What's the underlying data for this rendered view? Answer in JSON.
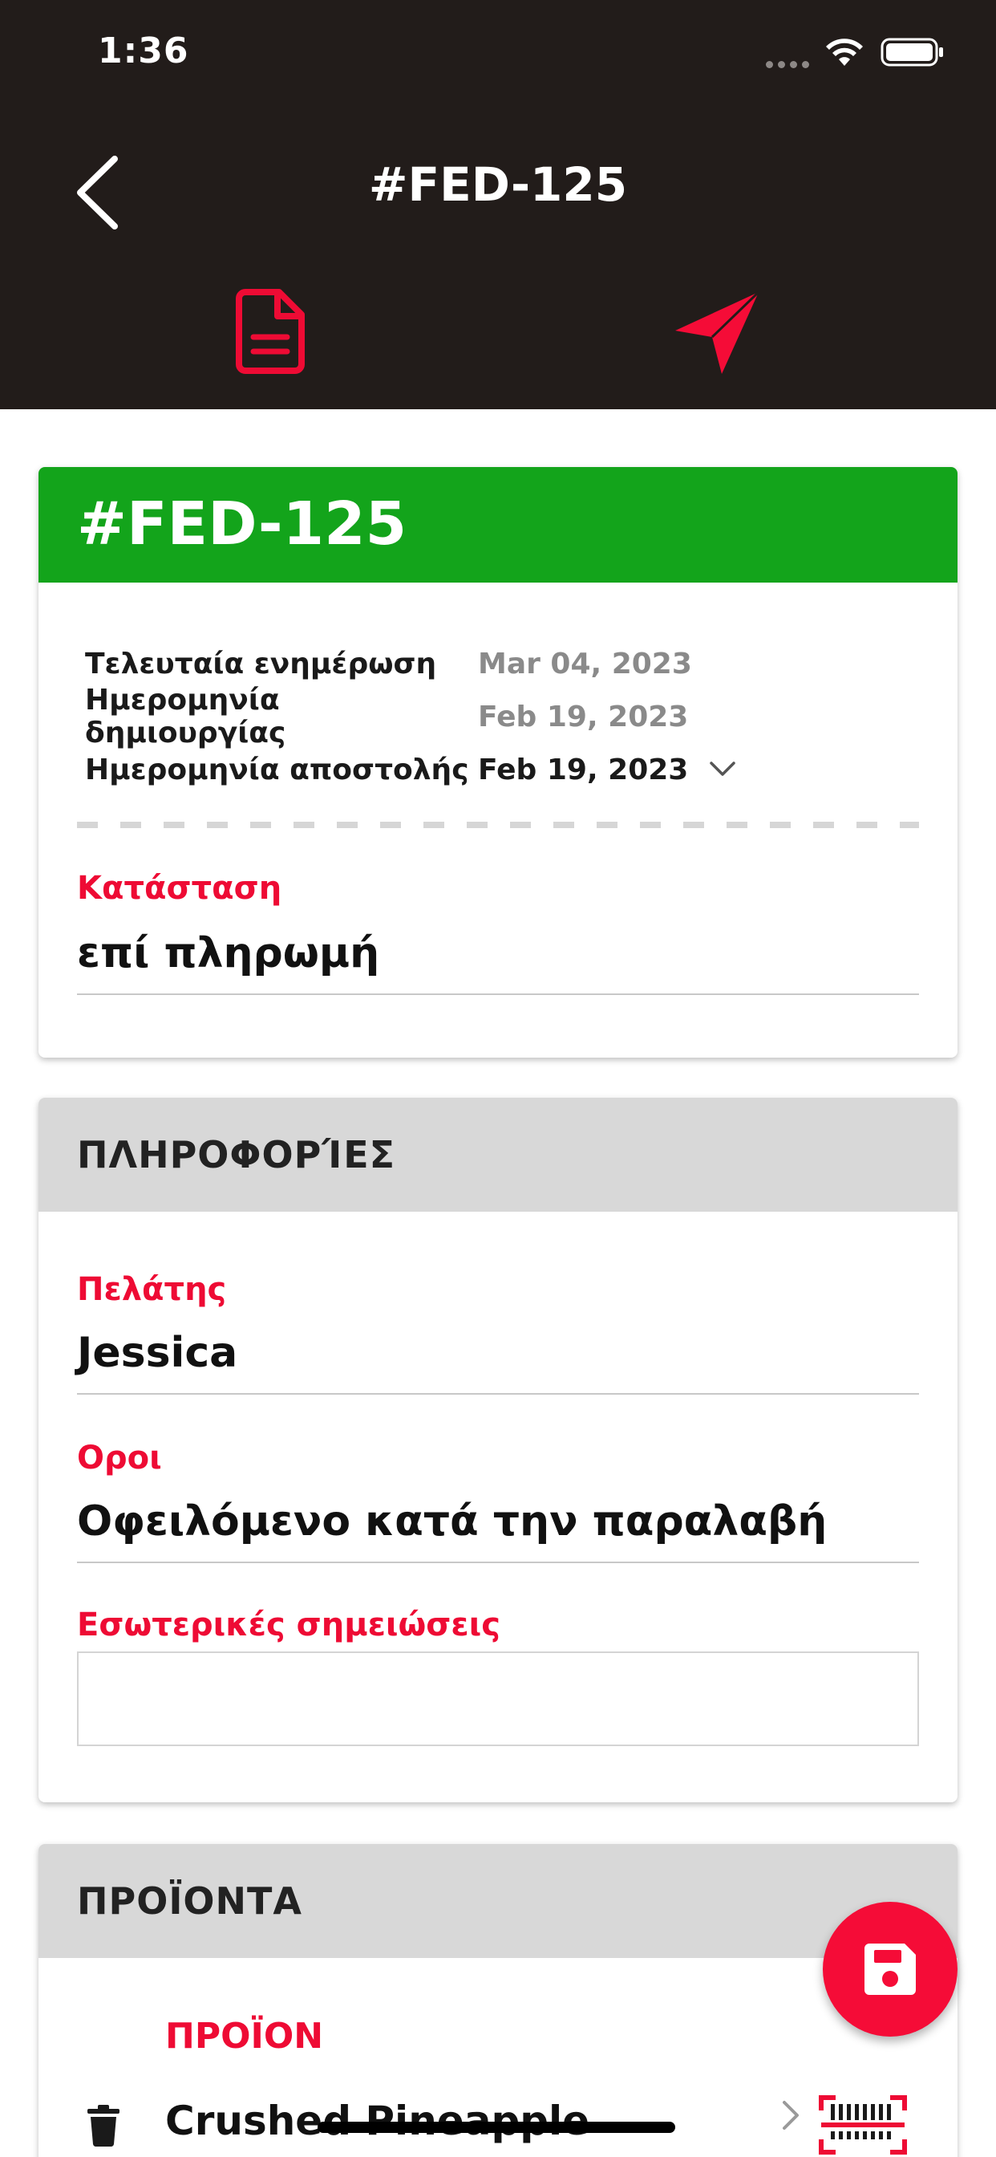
{
  "status_bar": {
    "time": "1:36"
  },
  "nav": {
    "title": "#FED-125",
    "back_icon": "chevron-left-icon",
    "tabs": [
      {
        "icon": "document-icon",
        "color": "#ee0b34"
      },
      {
        "icon": "send-icon",
        "color": "#f50c37"
      }
    ]
  },
  "order_card": {
    "header": "#FED-125",
    "header_color": "#13a41b",
    "meta": [
      {
        "label": "Τελευταία ενημέρωση",
        "value": "Mar 04, 2023"
      },
      {
        "label": "Ημερομηνία δημιουργίας",
        "value": "Feb 19, 2023"
      },
      {
        "label": "Ημερομηνία αποστολής",
        "value": "Feb 19, 2023"
      }
    ],
    "status_label": "Κατάσταση",
    "status_value": "επί πληρωμή"
  },
  "info_card": {
    "header": "ΠΛΗΡΟΦΟΡΊΕΣ",
    "customer_label": "Πελάτης",
    "customer_value": "Jessica",
    "terms_label": "Οροι",
    "terms_value": "Οφειλόμενο κατά την παραλαβή",
    "notes_label": "Εσωτερικές σημειώσεις",
    "notes_value": ""
  },
  "products_card": {
    "header": "ΠΡΟΪΟΝΤΑ",
    "column_label": "ΠΡΟΪΟΝ",
    "items": [
      {
        "name": "Crushed Pineapple"
      }
    ]
  },
  "fab": {
    "icon": "save-icon"
  },
  "colors": {
    "accent": "#ee0b34",
    "dark_bar": "#221c1a",
    "success": "#13a41b"
  }
}
